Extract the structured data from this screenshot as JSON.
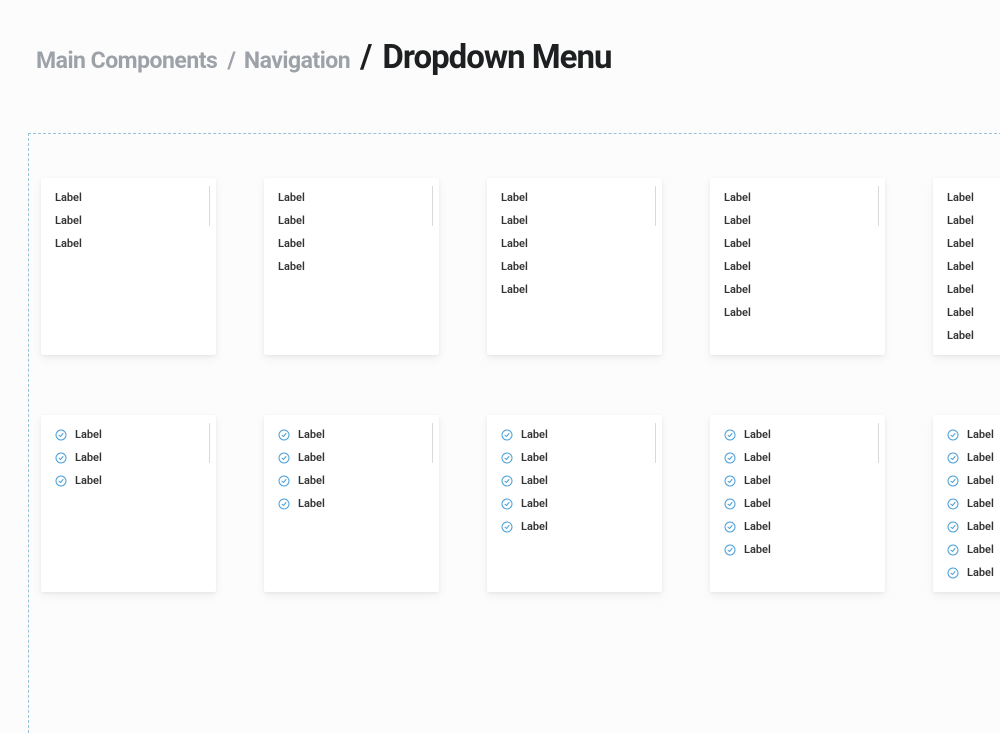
{
  "breadcrumb": {
    "part1": "Main Components",
    "sep1": "/",
    "part2": "Navigation",
    "sep2": "/",
    "title": "Dropdown Menu"
  },
  "item_label": "Label",
  "rows": [
    {
      "type": "plain",
      "counts": [
        3,
        4,
        5,
        6,
        7
      ]
    },
    {
      "type": "icon",
      "counts": [
        3,
        4,
        5,
        6,
        7
      ]
    }
  ]
}
